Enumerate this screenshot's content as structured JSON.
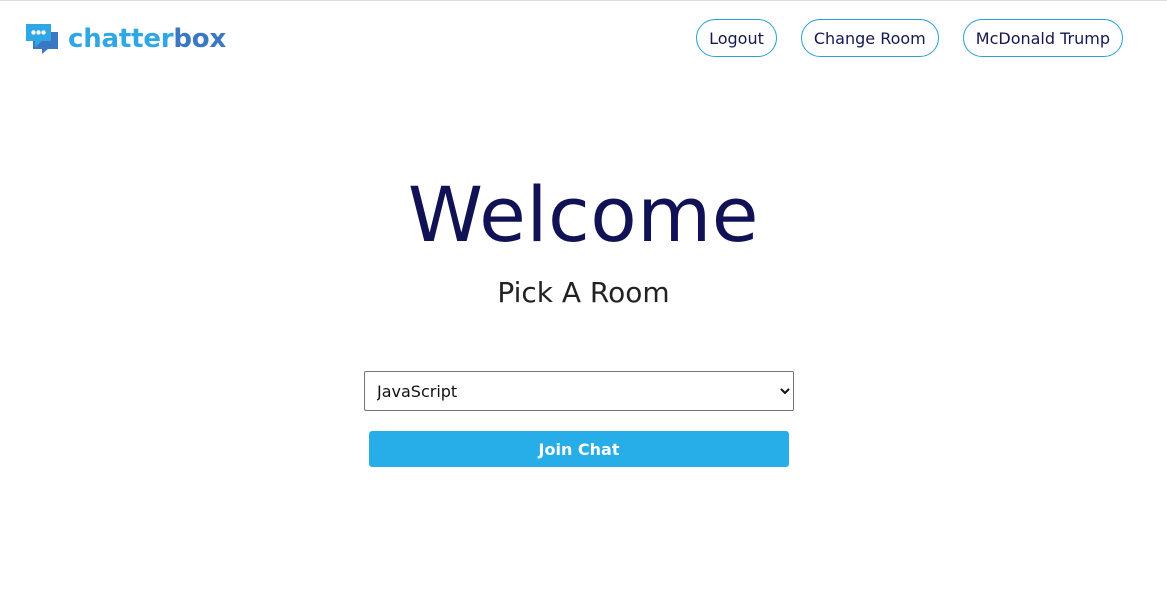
{
  "brand": {
    "name_part_1": "chatter",
    "name_part_2": "box",
    "icon": "chat-bubbles-icon",
    "colors": {
      "primary": "#2fa7e4",
      "secondary": "#3a78c2"
    }
  },
  "nav": {
    "logout_label": "Logout",
    "change_room_label": "Change Room",
    "user_label": "McDonald Trump"
  },
  "main": {
    "title": "Welcome",
    "subtitle": "Pick A Room",
    "room_select": {
      "selected": "JavaScript",
      "icon": "chevron-down-icon"
    },
    "join_label": "Join Chat"
  },
  "colors": {
    "heading": "#101255",
    "button": "#27aee9",
    "outline": "#27a1d6"
  }
}
